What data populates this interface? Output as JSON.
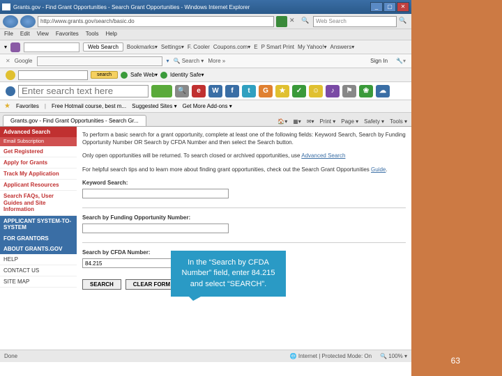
{
  "titlebar": {
    "text": "Grants.gov - Find Grant Opportunities - Search Grant Opportunities - Windows Internet Explorer"
  },
  "address": {
    "url": "http://www.grants.gov/search/basic.do",
    "search_placeholder": "Web Search"
  },
  "menubar": {
    "items": [
      "File",
      "Edit",
      "View",
      "Favorites",
      "Tools",
      "Help"
    ]
  },
  "tb1": {
    "websearch": "Web Search",
    "links": [
      "Bookmarks▾",
      "Settings▾",
      "F. Cooler",
      "Coupons.com▾",
      "E",
      "P Smart Print",
      "My Yahoo!▾",
      "Answers▾"
    ]
  },
  "tb2": {
    "google": "Google",
    "search": "Search",
    "more": "More »",
    "signin": "Sign In"
  },
  "tb3": {
    "search": "search",
    "safe": "Safe Web▾",
    "id": "Identity Safe▾"
  },
  "tb4": {
    "placeholder": "Enter search text here"
  },
  "favbar": {
    "fav": "Favorites",
    "sc": "Free Hotmail course, best m...",
    "sg": "Suggested Sites ▾",
    "gm": "Get More Add-ons ▾"
  },
  "tab": {
    "label": "Grants.gov - Find Grant Opportunities - Search Gr...",
    "tools": [
      "Home",
      "Feeds",
      "Print ▾",
      "Page ▾",
      "Safety ▾",
      "Tools ▾"
    ]
  },
  "sidebar": {
    "head": "Advanced Search",
    "sub": "Email Subscription",
    "reds": [
      "Get Registered",
      "Apply for Grants",
      "Track My Application",
      "Applicant Resources",
      "Search FAQs, User Guides and Site Information"
    ],
    "blues": [
      "APPLICANT SYSTEM-TO-SYSTEM",
      "FOR GRANTORS",
      "ABOUT GRANTS.GOV",
      "HELP",
      "CONTACT US",
      "SITE MAP"
    ]
  },
  "main": {
    "p1": "To perform a basic search for a grant opportunity, complete at least one of the following fields: Keyword Search, Search by Funding Opportunity Number OR Search by CFDA Number and then select the Search button.",
    "p2a": "Only open opportunities will be returned. To search closed or archived opportunities, use ",
    "p2link": "Advanced Search",
    "p3a": "For helpful search tips and to learn more about finding grant opportunities, check out the Search Grant Opportunities ",
    "p3link": "Guide",
    "p3b": ".",
    "label1": "Keyword Search:",
    "label2": "Search by Funding Opportunity Number:",
    "label3": "Search by CFDA Number:",
    "cfda_value": "84.215",
    "btn_search": "SEARCH",
    "btn_clear": "CLEAR FORM"
  },
  "callout": {
    "text": "In the “Search by CFDA Number” field, enter 84.215 and select “SEARCH”."
  },
  "status": {
    "done": "Done",
    "mode": "Internet | Protected Mode: On",
    "zoom": "100% ▾"
  },
  "pagenum": "63"
}
